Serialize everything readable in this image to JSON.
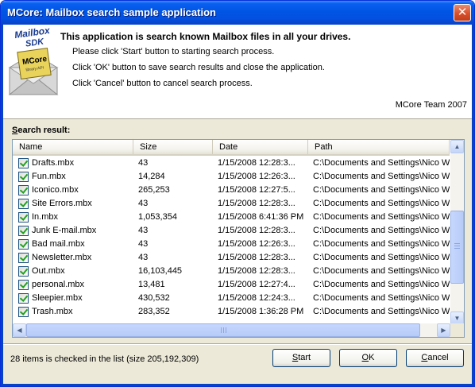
{
  "window": {
    "title": "MCore: Mailbox search sample application",
    "close_glyph": "✕"
  },
  "logo": {
    "line1": "Mailbox",
    "line2": "SDK",
    "line3": "MCore",
    "line4": "library API"
  },
  "header": {
    "title": "This application is search known Mailbox files in all your drives.",
    "line1": "Please click 'Start' button to starting search process.",
    "line2": "Click 'OK' button to save search results and close the application.",
    "line3": "Click 'Cancel' button to cancel search process.",
    "team": "MCore Team 2007"
  },
  "group": {
    "accel": "S",
    "rest": "earch result:"
  },
  "list": {
    "columns": [
      "Name",
      "Size",
      "Date",
      "Path"
    ],
    "rows": [
      [
        "Drafts.mbx",
        "43",
        "1/15/2008 12:28:3...",
        "C:\\Documents and Settings\\Nico W..."
      ],
      [
        "Fun.mbx",
        "14,284",
        "1/15/2008 12:26:3...",
        "C:\\Documents and Settings\\Nico W..."
      ],
      [
        "Iconico.mbx",
        "265,253",
        "1/15/2008 12:27:5...",
        "C:\\Documents and Settings\\Nico W..."
      ],
      [
        "Site Errors.mbx",
        "43",
        "1/15/2008 12:28:3...",
        "C:\\Documents and Settings\\Nico W..."
      ],
      [
        "In.mbx",
        "1,053,354",
        "1/15/2008 6:41:36 PM",
        "C:\\Documents and Settings\\Nico W..."
      ],
      [
        "Junk E-mail.mbx",
        "43",
        "1/15/2008 12:28:3...",
        "C:\\Documents and Settings\\Nico W..."
      ],
      [
        "Bad mail.mbx",
        "43",
        "1/15/2008 12:26:3...",
        "C:\\Documents and Settings\\Nico W..."
      ],
      [
        "Newsletter.mbx",
        "43",
        "1/15/2008 12:28:3...",
        "C:\\Documents and Settings\\Nico W..."
      ],
      [
        "Out.mbx",
        "16,103,445",
        "1/15/2008 12:28:3...",
        "C:\\Documents and Settings\\Nico W..."
      ],
      [
        "personal.mbx",
        "13,481",
        "1/15/2008 12:27:4...",
        "C:\\Documents and Settings\\Nico W..."
      ],
      [
        "Sleepier.mbx",
        "430,532",
        "1/15/2008 12:24:3...",
        "C:\\Documents and Settings\\Nico W..."
      ],
      [
        "Trash.mbx",
        "283,352",
        "1/15/2008 1:36:28 PM",
        "C:\\Documents and Settings\\Nico W..."
      ]
    ],
    "checked": true,
    "scroll_up_icon": "▲",
    "scroll_down_icon": "▼",
    "scroll_left_icon": "◀",
    "scroll_right_icon": "▶"
  },
  "status": "28 items is checked in the list (size 205,192,309)",
  "buttons": {
    "start": {
      "accel": "S",
      "rest": "tart"
    },
    "ok": {
      "accel": "O",
      "rest": "K"
    },
    "cancel": {
      "accel": "C",
      "rest": "ancel"
    }
  },
  "colors": {
    "titlebar": "#0055e5",
    "dialog": "#ece9d8",
    "list_border": "#7f9db9",
    "check": "#21a121"
  }
}
